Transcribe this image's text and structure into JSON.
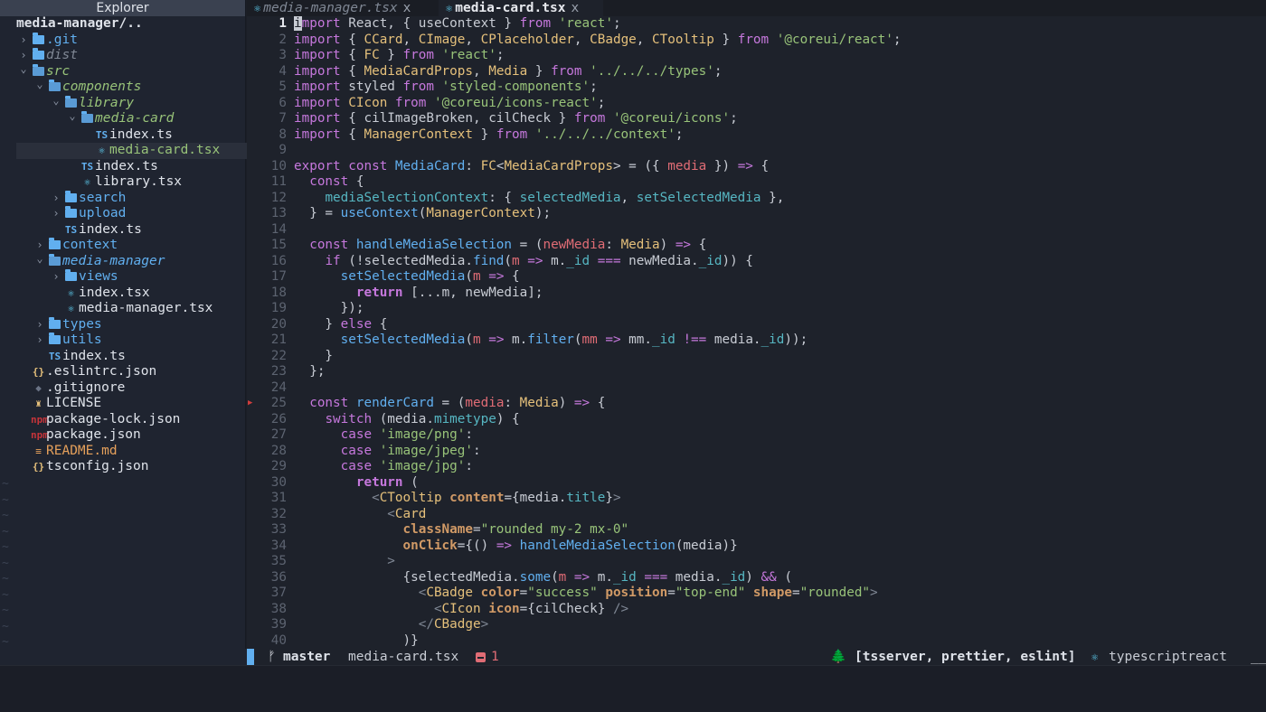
{
  "explorer": {
    "title": "Explorer",
    "root": "media-manager/..",
    "items": [
      {
        "label": ".git",
        "kind": "folder",
        "depth": 0,
        "open": false,
        "style": "blue"
      },
      {
        "label": "dist",
        "kind": "folder",
        "depth": 0,
        "open": false,
        "style": "dim-italic"
      },
      {
        "label": "src",
        "kind": "folder",
        "depth": 0,
        "open": true,
        "style": "green-italic"
      },
      {
        "label": "components",
        "kind": "folder",
        "depth": 1,
        "open": true,
        "style": "green-italic"
      },
      {
        "label": "library",
        "kind": "folder",
        "depth": 2,
        "open": true,
        "style": "green-italic"
      },
      {
        "label": "media-card",
        "kind": "folder",
        "depth": 3,
        "open": true,
        "style": "green-italic"
      },
      {
        "label": "index.ts",
        "kind": "ts",
        "depth": 4,
        "style": "white"
      },
      {
        "label": "media-card.tsx",
        "kind": "react",
        "depth": 4,
        "style": "green",
        "selected": true
      },
      {
        "label": "index.ts",
        "kind": "ts",
        "depth": 3,
        "style": "white"
      },
      {
        "label": "library.tsx",
        "kind": "react",
        "depth": 3,
        "style": "white"
      },
      {
        "label": "search",
        "kind": "folder",
        "depth": 2,
        "open": false,
        "style": "blue"
      },
      {
        "label": "upload",
        "kind": "folder",
        "depth": 2,
        "open": false,
        "style": "blue"
      },
      {
        "label": "index.ts",
        "kind": "ts",
        "depth": 2,
        "style": "white"
      },
      {
        "label": "context",
        "kind": "folder",
        "depth": 1,
        "open": false,
        "style": "blue"
      },
      {
        "label": "media-manager",
        "kind": "folder",
        "depth": 1,
        "open": true,
        "style": "blue-italic"
      },
      {
        "label": "views",
        "kind": "folder",
        "depth": 2,
        "open": false,
        "style": "blue"
      },
      {
        "label": "index.tsx",
        "kind": "react",
        "depth": 2,
        "style": "white"
      },
      {
        "label": "media-manager.tsx",
        "kind": "react",
        "depth": 2,
        "style": "white"
      },
      {
        "label": "types",
        "kind": "folder",
        "depth": 1,
        "open": false,
        "style": "blue"
      },
      {
        "label": "utils",
        "kind": "folder",
        "depth": 1,
        "open": false,
        "style": "blue"
      },
      {
        "label": "index.ts",
        "kind": "ts",
        "depth": 1,
        "style": "white"
      },
      {
        "label": ".eslintrc.json",
        "kind": "json",
        "depth": 0,
        "style": "white"
      },
      {
        "label": ".gitignore",
        "kind": "git",
        "depth": 0,
        "style": "white"
      },
      {
        "label": "LICENSE",
        "kind": "license",
        "depth": 0,
        "style": "white"
      },
      {
        "label": "package-lock.json",
        "kind": "npm",
        "depth": 0,
        "style": "white"
      },
      {
        "label": "package.json",
        "kind": "npm",
        "depth": 0,
        "style": "white"
      },
      {
        "label": "README.md",
        "kind": "md",
        "depth": 0,
        "style": "orange"
      },
      {
        "label": "tsconfig.json",
        "kind": "json",
        "depth": 0,
        "style": "white"
      }
    ]
  },
  "tabs": [
    {
      "label": "media-manager.tsx",
      "active": false,
      "close": "x"
    },
    {
      "label": "media-card.tsx",
      "active": true,
      "close": "x"
    }
  ],
  "editor": {
    "current_line": 1,
    "breakpoint_line": 25,
    "lines": [
      [
        [
          "k",
          "import"
        ],
        [
          "n",
          " React, { useContext } "
        ],
        [
          "k",
          "from"
        ],
        [
          "n",
          " "
        ],
        [
          "s",
          "'react'"
        ],
        [
          "n",
          ";"
        ]
      ],
      [
        [
          "k",
          "import"
        ],
        [
          "n",
          " { "
        ],
        [
          "t",
          "CCard"
        ],
        [
          "n",
          ", "
        ],
        [
          "t",
          "CImage"
        ],
        [
          "n",
          ", "
        ],
        [
          "t",
          "CPlaceholder"
        ],
        [
          "n",
          ", "
        ],
        [
          "t",
          "CBadge"
        ],
        [
          "n",
          ", "
        ],
        [
          "t",
          "CTooltip"
        ],
        [
          "n",
          " } "
        ],
        [
          "k",
          "from"
        ],
        [
          "n",
          " "
        ],
        [
          "s",
          "'@coreui/react'"
        ],
        [
          "n",
          ";"
        ]
      ],
      [
        [
          "k",
          "import"
        ],
        [
          "n",
          " { "
        ],
        [
          "t",
          "FC"
        ],
        [
          "n",
          " } "
        ],
        [
          "k",
          "from"
        ],
        [
          "n",
          " "
        ],
        [
          "s",
          "'react'"
        ],
        [
          "n",
          ";"
        ]
      ],
      [
        [
          "k",
          "import"
        ],
        [
          "n",
          " { "
        ],
        [
          "t",
          "MediaCardProps"
        ],
        [
          "n",
          ", "
        ],
        [
          "t",
          "Media"
        ],
        [
          "n",
          " } "
        ],
        [
          "k",
          "from"
        ],
        [
          "n",
          " "
        ],
        [
          "s",
          "'../../../types'"
        ],
        [
          "n",
          ";"
        ]
      ],
      [
        [
          "k",
          "import"
        ],
        [
          "n",
          " styled "
        ],
        [
          "k",
          "from"
        ],
        [
          "n",
          " "
        ],
        [
          "s",
          "'styled-components'"
        ],
        [
          "n",
          ";"
        ]
      ],
      [
        [
          "k",
          "import"
        ],
        [
          "n",
          " "
        ],
        [
          "t",
          "CIcon"
        ],
        [
          "n",
          " "
        ],
        [
          "k",
          "from"
        ],
        [
          "n",
          " "
        ],
        [
          "s",
          "'@coreui/icons-react'"
        ],
        [
          "n",
          ";"
        ]
      ],
      [
        [
          "k",
          "import"
        ],
        [
          "n",
          " { cilImageBroken, cilCheck } "
        ],
        [
          "k",
          "from"
        ],
        [
          "n",
          " "
        ],
        [
          "s",
          "'@coreui/icons'"
        ],
        [
          "n",
          ";"
        ]
      ],
      [
        [
          "k",
          "import"
        ],
        [
          "n",
          " { "
        ],
        [
          "t",
          "ManagerContext"
        ],
        [
          "n",
          " } "
        ],
        [
          "k",
          "from"
        ],
        [
          "n",
          " "
        ],
        [
          "s",
          "'../../../context'"
        ],
        [
          "n",
          ";"
        ]
      ],
      [],
      [
        [
          "k",
          "export"
        ],
        [
          "n",
          " "
        ],
        [
          "k",
          "const"
        ],
        [
          "n",
          " "
        ],
        [
          "f",
          "MediaCard"
        ],
        [
          "n",
          ": "
        ],
        [
          "t",
          "FC"
        ],
        [
          "n",
          "<"
        ],
        [
          "t",
          "MediaCardProps"
        ],
        [
          "n",
          "> = ({ "
        ],
        [
          "p",
          "media"
        ],
        [
          "n",
          " }) "
        ],
        [
          "op",
          "=>"
        ],
        [
          "n",
          " {"
        ]
      ],
      [
        [
          "n",
          "  "
        ],
        [
          "k",
          "const"
        ],
        [
          "n",
          " {"
        ]
      ],
      [
        [
          "n",
          "    "
        ],
        [
          "pr",
          "mediaSelectionContext"
        ],
        [
          "n",
          ": { "
        ],
        [
          "pr",
          "selectedMedia"
        ],
        [
          "n",
          ", "
        ],
        [
          "pr",
          "setSelectedMedia"
        ],
        [
          "n",
          " },"
        ]
      ],
      [
        [
          "n",
          "  } = "
        ],
        [
          "f",
          "useContext"
        ],
        [
          "n",
          "("
        ],
        [
          "t",
          "ManagerContext"
        ],
        [
          "n",
          ");"
        ]
      ],
      [],
      [
        [
          "n",
          "  "
        ],
        [
          "k",
          "const"
        ],
        [
          "n",
          " "
        ],
        [
          "f",
          "handleMediaSelection"
        ],
        [
          "n",
          " = ("
        ],
        [
          "p",
          "newMedia"
        ],
        [
          "n",
          ": "
        ],
        [
          "t",
          "Media"
        ],
        [
          "n",
          ") "
        ],
        [
          "op",
          "=>"
        ],
        [
          "n",
          " {"
        ]
      ],
      [
        [
          "n",
          "    "
        ],
        [
          "k",
          "if"
        ],
        [
          "n",
          " (!selectedMedia."
        ],
        [
          "f",
          "find"
        ],
        [
          "n",
          "("
        ],
        [
          "p",
          "m"
        ],
        [
          "n",
          " "
        ],
        [
          "op",
          "=>"
        ],
        [
          "n",
          " m."
        ],
        [
          "pr",
          "_id"
        ],
        [
          "n",
          " "
        ],
        [
          "op",
          "==="
        ],
        [
          "n",
          " newMedia."
        ],
        [
          "pr",
          "_id"
        ],
        [
          "n",
          ")) {"
        ]
      ],
      [
        [
          "n",
          "      "
        ],
        [
          "f",
          "setSelectedMedia"
        ],
        [
          "n",
          "("
        ],
        [
          "p",
          "m"
        ],
        [
          "n",
          " "
        ],
        [
          "op",
          "=>"
        ],
        [
          "n",
          " {"
        ]
      ],
      [
        [
          "n",
          "        "
        ],
        [
          "kb",
          "return"
        ],
        [
          "n",
          " [...m, newMedia];"
        ]
      ],
      [
        [
          "n",
          "      });"
        ]
      ],
      [
        [
          "n",
          "    } "
        ],
        [
          "k",
          "else"
        ],
        [
          "n",
          " {"
        ]
      ],
      [
        [
          "n",
          "      "
        ],
        [
          "f",
          "setSelectedMedia"
        ],
        [
          "n",
          "("
        ],
        [
          "p",
          "m"
        ],
        [
          "n",
          " "
        ],
        [
          "op",
          "=>"
        ],
        [
          "n",
          " m."
        ],
        [
          "f",
          "filter"
        ],
        [
          "n",
          "("
        ],
        [
          "p",
          "mm"
        ],
        [
          "n",
          " "
        ],
        [
          "op",
          "=>"
        ],
        [
          "n",
          " mm."
        ],
        [
          "pr",
          "_id"
        ],
        [
          "n",
          " "
        ],
        [
          "op",
          "!=="
        ],
        [
          "n",
          " media."
        ],
        [
          "pr",
          "_id"
        ],
        [
          "n",
          "));"
        ]
      ],
      [
        [
          "n",
          "    }"
        ]
      ],
      [
        [
          "n",
          "  };"
        ]
      ],
      [],
      [
        [
          "n",
          "  "
        ],
        [
          "k",
          "const"
        ],
        [
          "n",
          " "
        ],
        [
          "f",
          "renderCard"
        ],
        [
          "n",
          " = ("
        ],
        [
          "p",
          "media"
        ],
        [
          "n",
          ": "
        ],
        [
          "t",
          "Media"
        ],
        [
          "n",
          ") "
        ],
        [
          "op",
          "=>"
        ],
        [
          "n",
          " {"
        ]
      ],
      [
        [
          "n",
          "    "
        ],
        [
          "k",
          "switch"
        ],
        [
          "n",
          " (media."
        ],
        [
          "pr",
          "mimetype"
        ],
        [
          "n",
          ") {"
        ]
      ],
      [
        [
          "n",
          "      "
        ],
        [
          "k",
          "case"
        ],
        [
          "n",
          " "
        ],
        [
          "s",
          "'image/png'"
        ],
        [
          "n",
          ":"
        ]
      ],
      [
        [
          "n",
          "      "
        ],
        [
          "k",
          "case"
        ],
        [
          "n",
          " "
        ],
        [
          "s",
          "'image/jpeg'"
        ],
        [
          "n",
          ":"
        ]
      ],
      [
        [
          "n",
          "      "
        ],
        [
          "k",
          "case"
        ],
        [
          "n",
          " "
        ],
        [
          "s",
          "'image/jpg'"
        ],
        [
          "n",
          ":"
        ]
      ],
      [
        [
          "n",
          "        "
        ],
        [
          "kb",
          "return"
        ],
        [
          "n",
          " ("
        ]
      ],
      [
        [
          "n",
          "          "
        ],
        [
          "br",
          "<"
        ],
        [
          "tg",
          "CTooltip"
        ],
        [
          "n",
          " "
        ],
        [
          "at",
          "content"
        ],
        [
          "n",
          "={media."
        ],
        [
          "pr",
          "title"
        ],
        [
          "n",
          "}"
        ],
        [
          "br",
          ">"
        ]
      ],
      [
        [
          "n",
          "            "
        ],
        [
          "br",
          "<"
        ],
        [
          "tg",
          "Card"
        ]
      ],
      [
        [
          "n",
          "              "
        ],
        [
          "at",
          "className"
        ],
        [
          "n",
          "="
        ],
        [
          "s",
          "\"rounded my-2 mx-0\""
        ]
      ],
      [
        [
          "n",
          "              "
        ],
        [
          "at",
          "onClick"
        ],
        [
          "n",
          "={() "
        ],
        [
          "op",
          "=>"
        ],
        [
          "n",
          " "
        ],
        [
          "f",
          "handleMediaSelection"
        ],
        [
          "n",
          "(media)}"
        ]
      ],
      [
        [
          "n",
          "            "
        ],
        [
          "br",
          ">"
        ]
      ],
      [
        [
          "n",
          "              {selectedMedia."
        ],
        [
          "f",
          "some"
        ],
        [
          "n",
          "("
        ],
        [
          "p",
          "m"
        ],
        [
          "n",
          " "
        ],
        [
          "op",
          "=>"
        ],
        [
          "n",
          " m."
        ],
        [
          "pr",
          "_id"
        ],
        [
          "n",
          " "
        ],
        [
          "op",
          "==="
        ],
        [
          "n",
          " media."
        ],
        [
          "pr",
          "_id"
        ],
        [
          "n",
          ") "
        ],
        [
          "op",
          "&&"
        ],
        [
          "n",
          " ("
        ]
      ],
      [
        [
          "n",
          "                "
        ],
        [
          "br",
          "<"
        ],
        [
          "tg",
          "CBadge"
        ],
        [
          "n",
          " "
        ],
        [
          "at",
          "color"
        ],
        [
          "n",
          "="
        ],
        [
          "s",
          "\"success\""
        ],
        [
          "n",
          " "
        ],
        [
          "at",
          "position"
        ],
        [
          "n",
          "="
        ],
        [
          "s",
          "\"top-end\""
        ],
        [
          "n",
          " "
        ],
        [
          "at",
          "shape"
        ],
        [
          "n",
          "="
        ],
        [
          "s",
          "\"rounded\""
        ],
        [
          "br",
          ">"
        ]
      ],
      [
        [
          "n",
          "                  "
        ],
        [
          "br",
          "<"
        ],
        [
          "tg",
          "CIcon"
        ],
        [
          "n",
          " "
        ],
        [
          "at",
          "icon"
        ],
        [
          "n",
          "={cilCheck} "
        ],
        [
          "br",
          "/>"
        ]
      ],
      [
        [
          "n",
          "                "
        ],
        [
          "br",
          "</"
        ],
        [
          "tg",
          "CBadge"
        ],
        [
          "br",
          ">"
        ]
      ],
      [
        [
          "n",
          "              )}"
        ]
      ]
    ]
  },
  "statusbar": {
    "branch_icon": "ᚠ",
    "branch": "master",
    "file": "media-card.tsx",
    "errors": "1",
    "tree_icon": "🌲",
    "lsp": "[tsserver, prettier, eslint]",
    "lang": "typescriptreact",
    "end": "__"
  },
  "colors": {
    "accent": "#61afef",
    "keyword": "#c678dd",
    "type": "#e5c07b",
    "string": "#98c379",
    "error": "#e06c75"
  }
}
